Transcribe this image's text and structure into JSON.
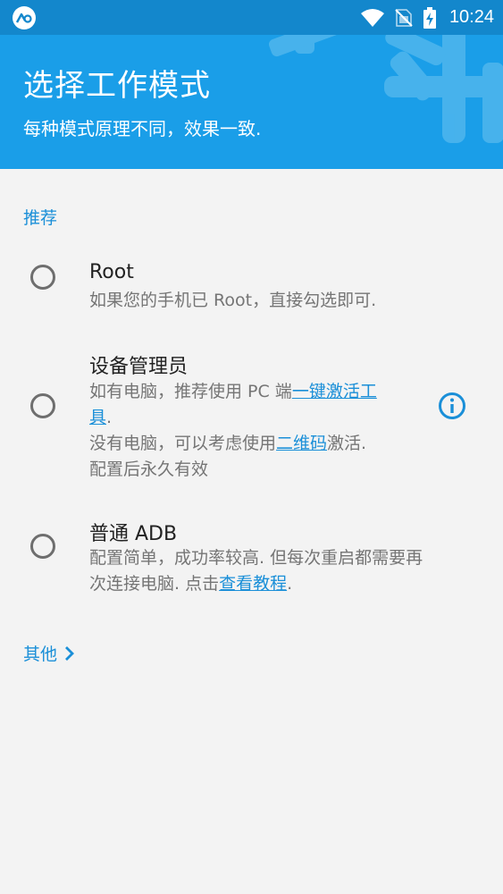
{
  "status_bar": {
    "app_icon": "app-logo-icon",
    "time": "10:24",
    "icons": [
      "wifi-icon",
      "no-sim-icon",
      "battery-charging-icon"
    ]
  },
  "header": {
    "title": "选择工作模式",
    "subtitle": "每种模式原理不同，效果一致.",
    "background_color": "#1a9ee8"
  },
  "recommended": {
    "label": "推荐",
    "options": [
      {
        "title": "Root",
        "desc": "如果您的手机已 Root，直接勾选即可."
      },
      {
        "title": "设备管理员",
        "line1_prefix": "如有电脑，推荐使用 PC 端",
        "line1_link_a": "一键激活工",
        "line2_link_b": "具",
        "line2_suffix": ".",
        "line3_prefix": "没有电脑，可以考虑使用",
        "line3_link": "二维码",
        "line3_suffix": "激活.",
        "line4": "配置后永久有效"
      },
      {
        "title": "普通 ADB",
        "line1": "配置简单，成功率较高. 但每次重启都需要再",
        "line2_prefix": "次连接电脑. 点击",
        "line2_link": "查看教程",
        "line2_suffix": "."
      }
    ]
  },
  "other": {
    "label": "其他"
  },
  "colors": {
    "accent": "#1a8fd8",
    "status_bar": "#1387cc",
    "background": "#f3f3f3"
  }
}
